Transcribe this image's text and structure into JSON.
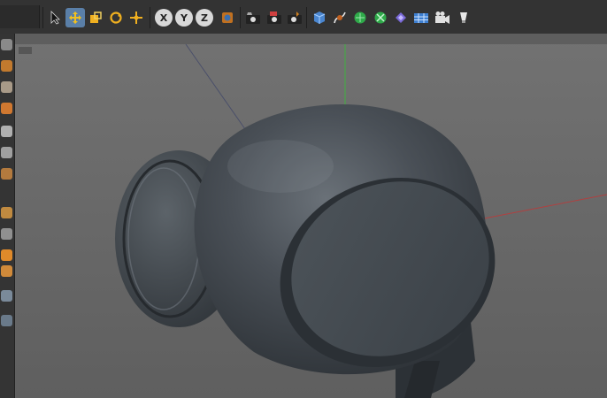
{
  "toolbar": {
    "axis_x": "X",
    "axis_y": "Y",
    "axis_z": "Z"
  },
  "icons": [
    "cursor-icon",
    "move-icon",
    "scale-icon",
    "rotate-icon",
    "transform-icon",
    "lock-x-icon",
    "lock-y-icon",
    "lock-z-icon",
    "world-coordinates-icon",
    "render-view-icon",
    "render-picture-queue-icon",
    "render-settings-icon",
    "cube-primitive-icon",
    "pen-spline-icon",
    "subdivision-generator-icon",
    "cloner-mograph-icon",
    "deformer-icon",
    "floor-environment-icon",
    "camera-icon",
    "light-icon"
  ],
  "viewport": {
    "background": "#6c6c6c",
    "object_color": "#3f454b",
    "axis_x_color": "#b04040",
    "axis_y_color": "#40b040"
  }
}
